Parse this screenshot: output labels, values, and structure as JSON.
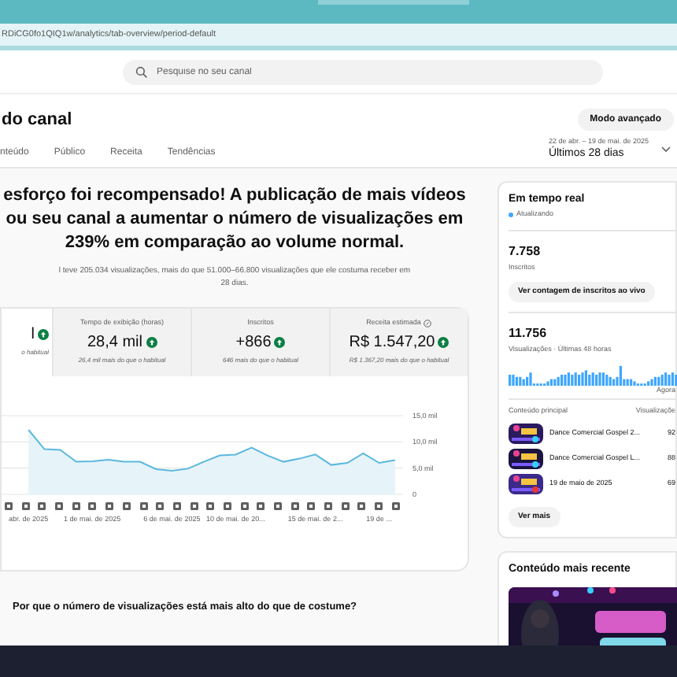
{
  "browser": {
    "url": "RDiCG0fo1QIQ1w/analytics/tab-overview/period-default"
  },
  "search": {
    "placeholder": "Pesquise no seu canal"
  },
  "page_title": "do canal",
  "advanced_button": "Modo avançado",
  "tabs": [
    {
      "label": "nteúdo",
      "selected": false
    },
    {
      "label": "Público",
      "selected": false
    },
    {
      "label": "Receita",
      "selected": false
    },
    {
      "label": "Tendências",
      "selected": false
    }
  ],
  "period": {
    "range": "22 de abr. – 19 de mai. de 2025",
    "label": "Últimos 28 dias"
  },
  "headline_lines": [
    "esforço foi recompensado! A publicação de mais vídeos",
    "ou seu canal a aumentar o número de visualizações em",
    "239% em comparação ao volume normal."
  ],
  "summary_lines": [
    "l teve 205.034 visualizações, mais do que 51.000–66.800 visualizações que ele costuma receber em",
    "28 dias."
  ],
  "metrics": [
    {
      "kind": "plain",
      "value": "l",
      "note": "o habitual",
      "selected": true
    },
    {
      "kind": "plain",
      "label": "Tempo de exibição (horas)",
      "value": "28,4 mil",
      "note": "26,4 mil mais do que o habitual",
      "selected": false
    },
    {
      "kind": "plain",
      "label": "Inscritos",
      "value": "+866",
      "note": "646 mais do que o habitual",
      "selected": false
    },
    {
      "kind": "revenue",
      "label": "Receita estimada",
      "value": "R$ 1.547,20",
      "note": "R$ 1.367,20 mais do que o habitual",
      "selected": false
    }
  ],
  "chart_data": {
    "type": "area",
    "values": [
      12.3,
      8.6,
      8.5,
      6.2,
      6.3,
      6.6,
      6.2,
      6.2,
      4.8,
      4.5,
      4.9,
      6.2,
      7.4,
      7.6,
      8.9,
      7.4,
      6.2,
      6.8,
      7.6,
      5.6,
      6.0,
      7.8,
      6.0,
      6.5
    ],
    "ylim": [
      0,
      15
    ],
    "yticks": [
      {
        "value": 0,
        "label": "0"
      },
      {
        "value": 5,
        "label": "5,0 mil"
      },
      {
        "value": 10,
        "label": "10,0 mil"
      },
      {
        "value": 15,
        "label": "15,0 mil"
      }
    ],
    "categories": [
      "abr. de 2025",
      null,
      null,
      null,
      "1 de mai. de 2025",
      null,
      null,
      null,
      null,
      "6 de mai. de 2025",
      null,
      null,
      null,
      "10 de mai. de 20...",
      null,
      null,
      null,
      null,
      "15 de mai. de 2...",
      null,
      null,
      null,
      "19 de ...",
      null
    ]
  },
  "question": "Por que o número de visualizações está mais alto do que de costume?",
  "realtime": {
    "title": "Em tempo real",
    "status": "Atualizando",
    "subscribers": "7.758",
    "subscribers_label": "Inscritos",
    "live_button": "Ver contagem de inscritos ao vivo",
    "views": "11.756",
    "views_label": "Visualizações · Últimas 48 horas",
    "now_label": "Agora",
    "top_header": "Conteúdo principal",
    "views_header": "Visualizaçõe",
    "top_items": [
      {
        "title": "Dance Comercial Gospel 2...",
        "views": "92"
      },
      {
        "title": "Dance Comercial Gospel L...",
        "views": "88"
      },
      {
        "title": "19 de maio de 2025",
        "views": "69"
      }
    ],
    "more_button": "Ver mais"
  },
  "latest": {
    "title": "Conteúdo mais recente"
  }
}
